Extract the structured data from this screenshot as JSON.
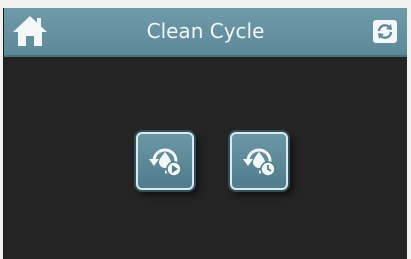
{
  "header": {
    "title": "Clean Cycle",
    "home_icon": "home-icon",
    "refresh_icon": "refresh-icon"
  },
  "buttons": [
    {
      "name": "start-cycle-button",
      "icon": "cycle-play-icon"
    },
    {
      "name": "schedule-cycle-button",
      "icon": "cycle-clock-icon"
    }
  ],
  "colors": {
    "header": "#5d8998",
    "background": "#242424",
    "button": "#5e8b9a",
    "text": "#f4f7f8"
  }
}
